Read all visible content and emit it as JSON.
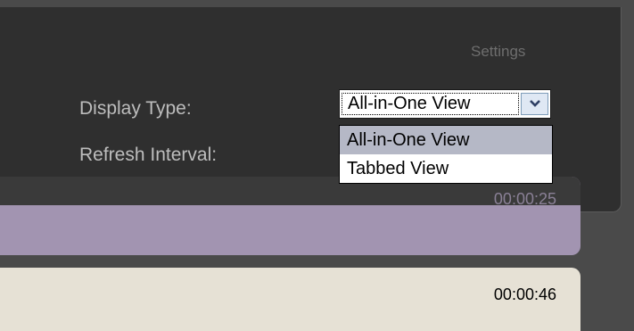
{
  "settings": {
    "title": "Settings",
    "display_type_label": "Display Type:",
    "refresh_interval_label": "Refresh Interval:",
    "display_type": {
      "selected": "All-in-One View",
      "options": [
        "All-in-One View",
        "Tabbed View"
      ]
    }
  },
  "items": [
    {
      "time": "00:00:25",
      "color": "#a294b1"
    },
    {
      "time": "00:00:46",
      "color": "#e6e1d5"
    }
  ]
}
